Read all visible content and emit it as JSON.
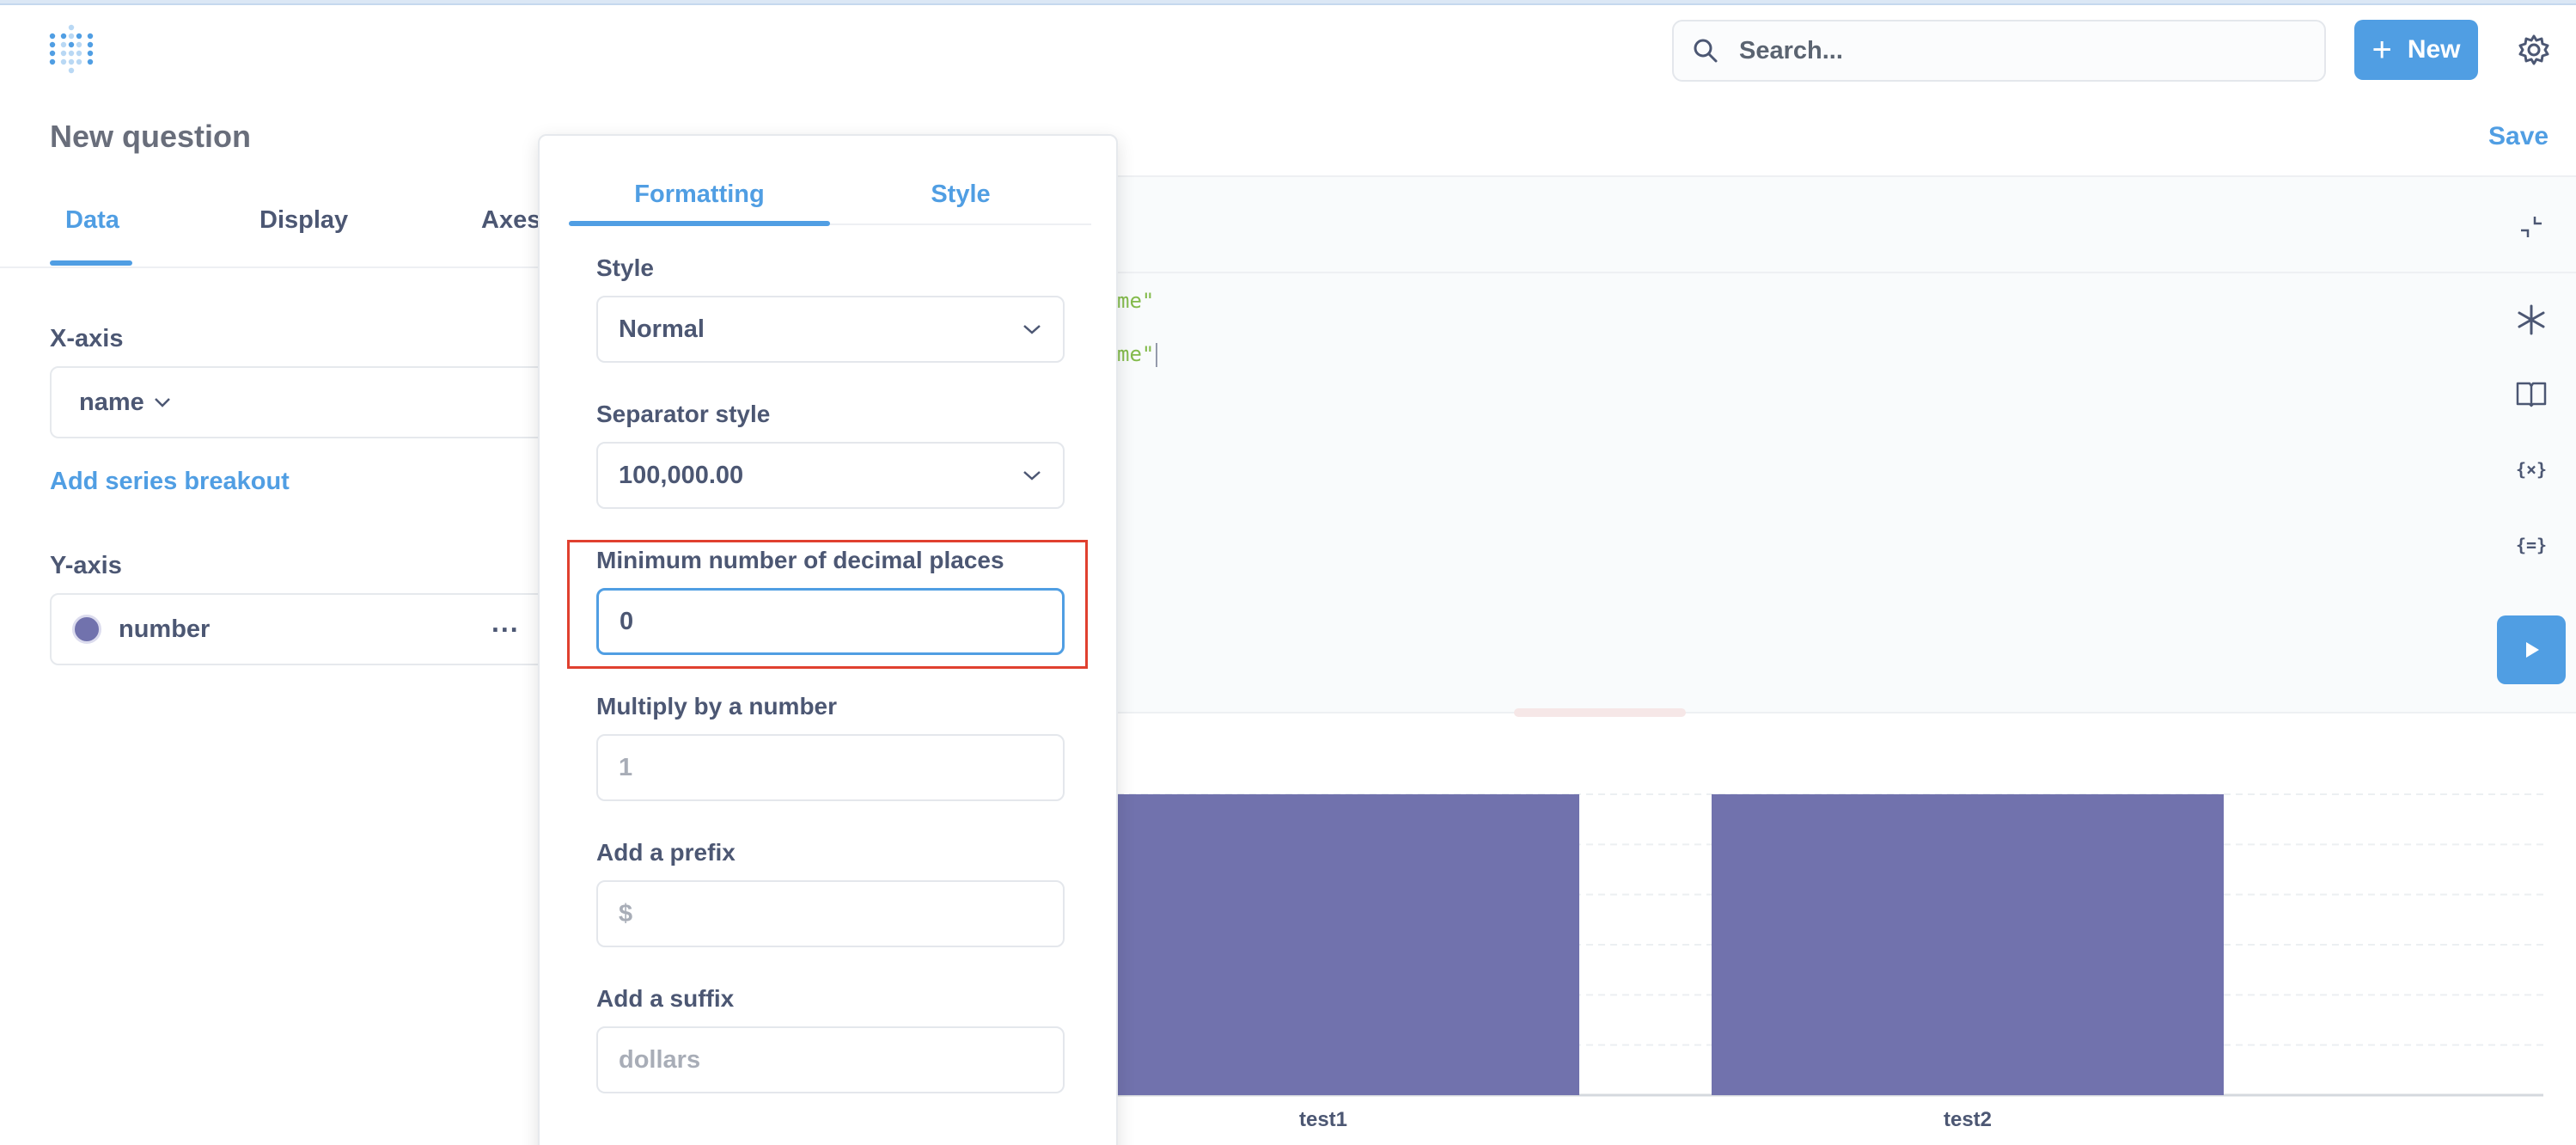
{
  "header": {
    "logo_icon": "metabase-logo-icon",
    "search_placeholder": "Search...",
    "new_label": "New",
    "new_icon": "plus-icon",
    "settings_icon": "gear-icon"
  },
  "question": {
    "title": "New question",
    "save_label": "Save"
  },
  "sidebar": {
    "tabs": [
      {
        "label": "Data",
        "active": true
      },
      {
        "label": "Display",
        "active": false
      },
      {
        "label": "Axes",
        "active": false
      }
    ],
    "x_axis_label": "X-axis",
    "x_axis_value": "name",
    "add_series_breakout": "Add series breakout",
    "y_axis_label": "Y-axis",
    "y_axis_value": "number",
    "y_axis_color": "#7172ad",
    "y_axis_menu": "..."
  },
  "editor": {
    "code_lines": [
      "me\"",
      "me\""
    ],
    "icons": [
      "collapse-icon",
      "snippet-asterisk-icon",
      "data-reference-book-icon",
      "variables-icon",
      "snippets-braces-icon"
    ],
    "run_icon": "play-icon"
  },
  "popover": {
    "tabs": [
      {
        "label": "Formatting",
        "active": true
      },
      {
        "label": "Style",
        "active": false
      }
    ],
    "style_label": "Style",
    "style_value": "Normal",
    "separator_label": "Separator style",
    "separator_value": "100,000.00",
    "decimal_label": "Minimum number of decimal places",
    "decimal_value": "0",
    "multiply_label": "Multiply by a number",
    "multiply_placeholder": "1",
    "prefix_label": "Add a prefix",
    "prefix_placeholder": "$",
    "suffix_label": "Add a suffix",
    "suffix_placeholder": "dollars"
  },
  "chart_data": {
    "type": "bar",
    "categories": [
      "test1",
      "test2"
    ],
    "series": [
      {
        "values": [
          1,
          1
        ]
      }
    ],
    "color": "#7172ad",
    "grid": true
  },
  "colors": {
    "accent": "#509ee3",
    "text": "#4c5773",
    "highlight": "#e0402f"
  }
}
